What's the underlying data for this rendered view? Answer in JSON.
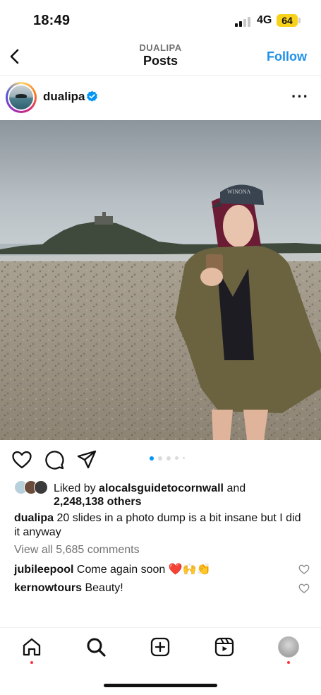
{
  "status_bar": {
    "time": "18:49",
    "network": "4G",
    "battery": "64"
  },
  "header": {
    "account": "DUALIPA",
    "title": "Posts",
    "follow_label": "Follow"
  },
  "post": {
    "username": "dualipa",
    "liked_by_prefix": "Liked by",
    "liked_by_user": "alocalsguidetocornwall",
    "liked_by_and": "and",
    "likes_count": "2,248,138 others",
    "caption_user": "dualipa",
    "caption_text": "20 slides in a photo dump is a bit insane but I did it anyway",
    "view_comments": "View all 5,685 comments",
    "comments": [
      {
        "user": "jubileepool",
        "text": "Come again soon ❤️🙌👏"
      },
      {
        "user": "kernowtours",
        "text": "Beauty!"
      }
    ],
    "cap_text": "WINONA",
    "carousel": {
      "total_dots": 5,
      "active_index": 0
    }
  },
  "colors": {
    "accent": "#1e90e8",
    "verified": "#0095f6",
    "notification": "#ff3040"
  },
  "icons": [
    "back-icon",
    "verified-icon",
    "more-icon",
    "heart-icon",
    "comment-icon",
    "share-icon",
    "home-icon",
    "search-icon",
    "create-icon",
    "reels-icon",
    "profile-avatar"
  ]
}
